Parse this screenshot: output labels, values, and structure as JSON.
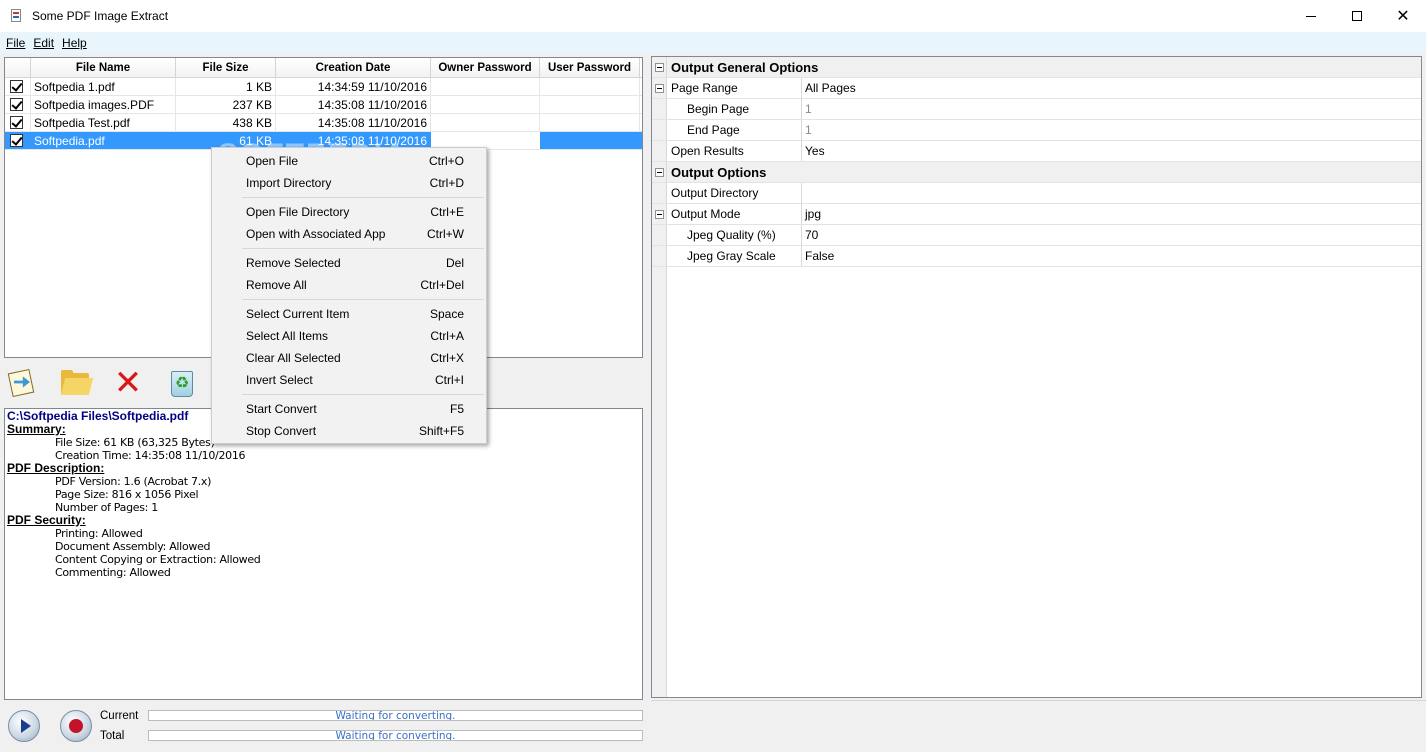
{
  "window": {
    "title": "Some PDF Image Extract",
    "controls": {
      "minimize": "minimize-icon",
      "maximize": "maximize-icon",
      "close": "✕"
    }
  },
  "menubar": [
    {
      "label": "File"
    },
    {
      "label": "Edit"
    },
    {
      "label": "Help"
    }
  ],
  "filelist": {
    "columns": [
      "File Name",
      "File Size",
      "Creation Date",
      "Owner Password",
      "User Password"
    ],
    "rows": [
      {
        "checked": true,
        "name": "Softpedia 1.pdf",
        "size": "1 KB",
        "date": "14:34:59 11/10/2016",
        "owner": "",
        "user": ""
      },
      {
        "checked": true,
        "name": "Softpedia images.PDF",
        "size": "237 KB",
        "date": "14:35:08 11/10/2016",
        "owner": "",
        "user": ""
      },
      {
        "checked": true,
        "name": "Softpedia Test.pdf",
        "size": "438 KB",
        "date": "14:35:08 11/10/2016",
        "owner": "",
        "user": ""
      },
      {
        "checked": true,
        "name": "Softpedia.pdf",
        "size": "61 KB",
        "date": "14:35:08 11/10/2016",
        "owner": "",
        "user": "",
        "selected": true
      }
    ]
  },
  "toolbar": {
    "icons": [
      "open-file-icon",
      "open-folder-icon",
      "delete-icon",
      "recycle-bin-icon"
    ]
  },
  "info": {
    "path": "C:\\Softpedia Files\\Softpedia.pdf",
    "summary_title": "Summary:",
    "file_size": "File Size: 61 KB (63,325 Bytes)",
    "creation_time": "Creation Time: 14:35:08 11/10/2016",
    "desc_title": "PDF Description:",
    "pdf_version": "PDF Version: 1.6 (Acrobat 7.x)",
    "page_size": "Page Size: 816 x 1056 Pixel",
    "num_pages": "Number of Pages: 1",
    "security_title": "PDF Security:",
    "printing": "Printing: Allowed",
    "assembly": "Document Assembly: Allowed",
    "copying": "Content Copying or Extraction: Allowed",
    "commenting": "Commenting: Allowed"
  },
  "status": {
    "current_label": "Current",
    "total_label": "Total",
    "current_text": "Waiting for converting.",
    "total_text": "Waiting for converting.",
    "current_progress": 0,
    "total_progress": 0
  },
  "properties": {
    "general_title": "Output General Options",
    "page_range_label": "Page Range",
    "page_range_value": "All Pages",
    "begin_page_label": "Begin Page",
    "begin_page_value": "1",
    "end_page_label": "End Page",
    "end_page_value": "1",
    "open_results_label": "Open Results",
    "open_results_value": "Yes",
    "output_title": "Output Options",
    "output_dir_label": "Output Directory",
    "output_dir_value": "",
    "output_mode_label": "Output Mode",
    "output_mode_value": "jpg",
    "jpeg_quality_label": "Jpeg Quality (%)",
    "jpeg_quality_value": "70",
    "jpeg_gray_label": "Jpeg Gray Scale",
    "jpeg_gray_value": "False"
  },
  "context_menu": [
    {
      "label": "Open File",
      "shortcut": "Ctrl+O"
    },
    {
      "label": "Import Directory",
      "shortcut": "Ctrl+D"
    },
    {
      "label": "Open File Directory",
      "shortcut": "Ctrl+E"
    },
    {
      "label": "Open with Associated App",
      "shortcut": "Ctrl+W"
    },
    {
      "label": "Remove Selected",
      "shortcut": "Del"
    },
    {
      "label": "Remove All",
      "shortcut": "Ctrl+Del"
    },
    {
      "label": "Select Current Item",
      "shortcut": "Space"
    },
    {
      "label": "Select All Items",
      "shortcut": "Ctrl+A"
    },
    {
      "label": "Clear All Selected",
      "shortcut": "Ctrl+X"
    },
    {
      "label": "Invert Select",
      "shortcut": "Ctrl+I"
    },
    {
      "label": "Start Convert",
      "shortcut": "F5"
    },
    {
      "label": "Stop Convert",
      "shortcut": "Shift+F5"
    }
  ],
  "colors": {
    "selection": "#3399ff",
    "menubar_bg": "#e9f5fc",
    "info_path": "#000080",
    "progress_text": "#3a6fc9"
  },
  "watermark": "SOFTPEDIA"
}
